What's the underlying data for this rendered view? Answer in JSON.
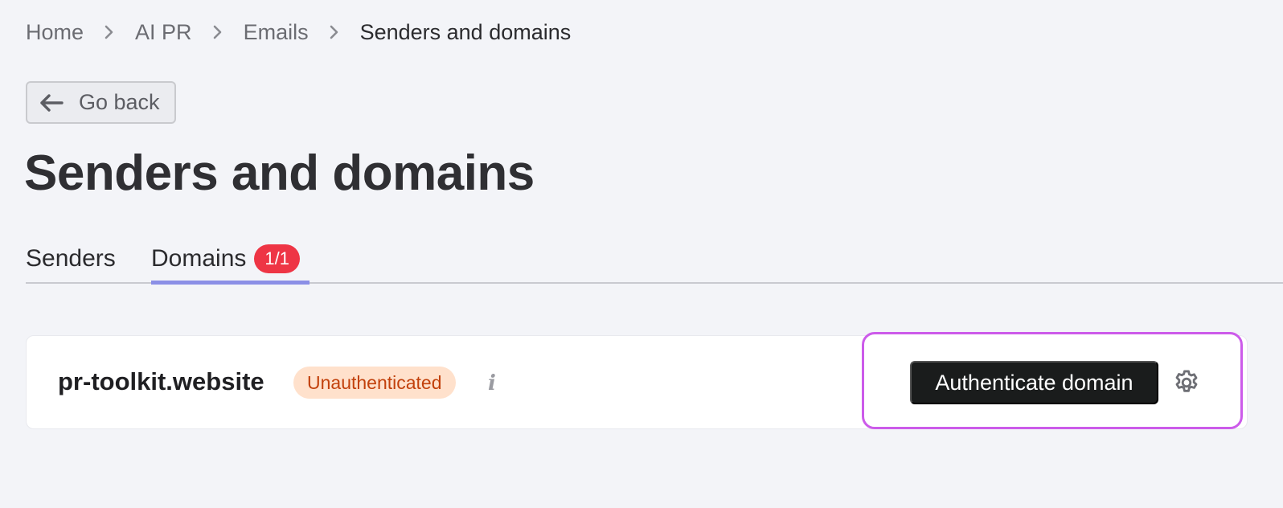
{
  "breadcrumb": {
    "items": [
      "Home",
      "AI PR",
      "Emails",
      "Senders and domains"
    ]
  },
  "go_back": {
    "label": "Go back",
    "icon": "arrow-left-icon"
  },
  "page": {
    "title": "Senders and domains"
  },
  "tabs": [
    {
      "label": "Senders",
      "active": false
    },
    {
      "label": "Domains",
      "badge": "1/1",
      "active": true
    }
  ],
  "domain": {
    "name": "pr-toolkit.website",
    "status": "Unauthenticated",
    "info_glyph": "i",
    "authenticate_label": "Authenticate domain",
    "settings_icon": "gear-icon"
  },
  "colors": {
    "accent_tab": "#8b8fe6",
    "badge_red": "#ee3545",
    "status_bg": "#ffe1cc",
    "status_text": "#c2410c",
    "highlight": "#cc5bea",
    "primary_button": "#1a1c1c"
  }
}
